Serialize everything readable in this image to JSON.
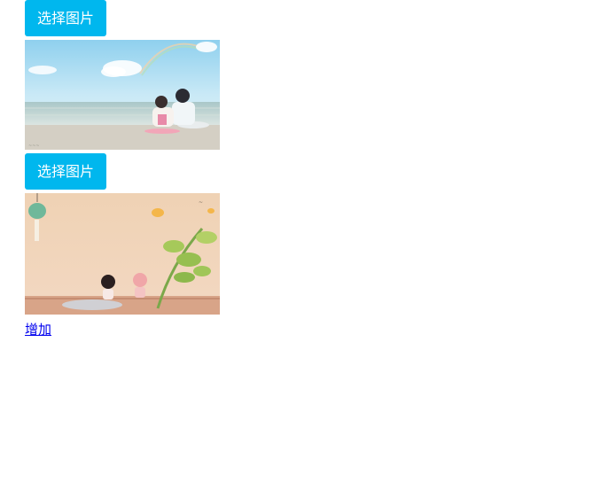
{
  "uploads": [
    {
      "button_label": "选择图片",
      "image": "beach-couple-photo"
    },
    {
      "button_label": "选择图片",
      "image": "cartoon-kids-plant-illustration"
    }
  ],
  "add_link_label": "增加"
}
